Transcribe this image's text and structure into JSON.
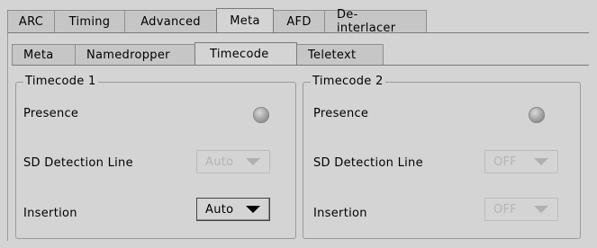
{
  "outer_tabs": [
    {
      "label": "ARC",
      "active": false
    },
    {
      "label": "Timing",
      "active": false
    },
    {
      "label": "Advanced",
      "active": false
    },
    {
      "label": "Meta",
      "active": true
    },
    {
      "label": "AFD",
      "active": false
    },
    {
      "label": "De-interlacer",
      "active": false
    }
  ],
  "inner_tabs": [
    {
      "label": "Meta",
      "active": false
    },
    {
      "label": "Namedropper",
      "active": false
    },
    {
      "label": "Timecode",
      "active": true
    },
    {
      "label": "Teletext",
      "active": false
    }
  ],
  "timecode1": {
    "title": "Timecode 1",
    "presence_label": "Presence",
    "sd_line_label": "SD Detection Line",
    "sd_line_value": "Auto",
    "insertion_label": "Insertion",
    "insertion_value": "Auto"
  },
  "timecode2": {
    "title": "Timecode 2",
    "presence_label": "Presence",
    "sd_line_label": "SD Detection Line",
    "sd_line_value": "OFF",
    "insertion_label": "Insertion",
    "insertion_value": "OFF"
  },
  "colors": {
    "background": "#d4d4d4",
    "tab_inactive": "#c6c6c6",
    "disabled_text": "#b4b4b4",
    "led_off": "#a8a8a8"
  },
  "icons": {
    "presence_indicator": "led-off-icon",
    "dropdown_arrow": "triangle-down-icon"
  }
}
